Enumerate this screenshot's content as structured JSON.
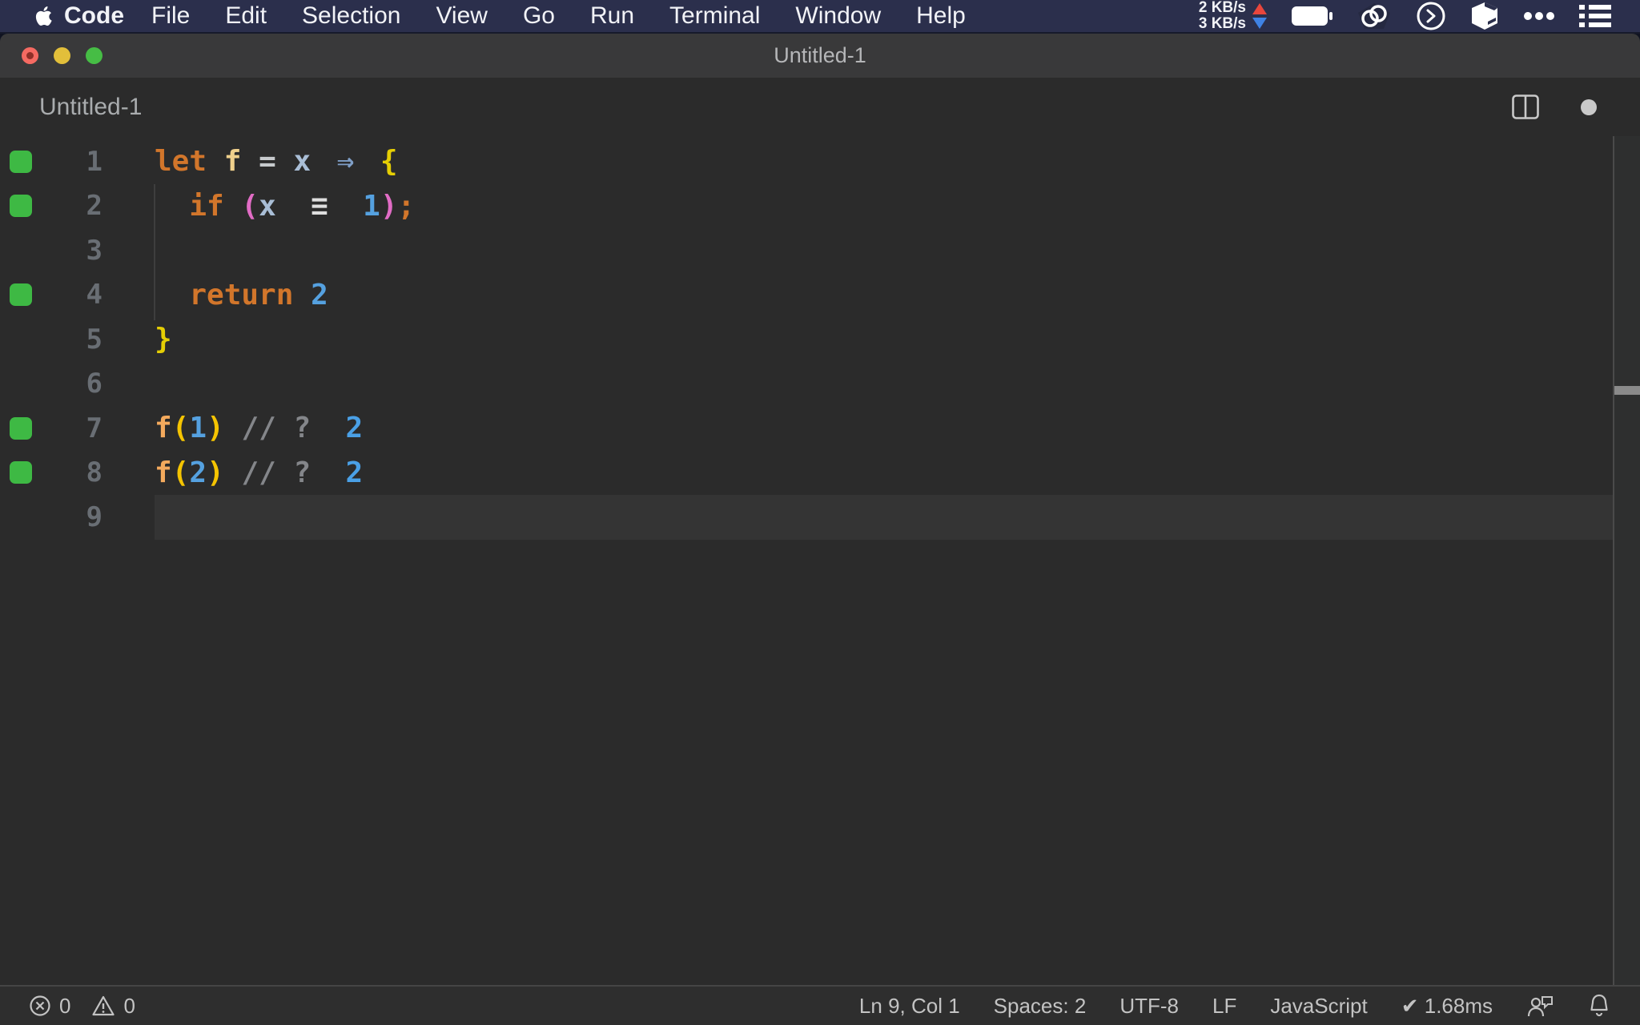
{
  "menu_bar": {
    "app_name": "Code",
    "items": [
      "File",
      "Edit",
      "Selection",
      "View",
      "Go",
      "Run",
      "Terminal",
      "Window",
      "Help"
    ],
    "network_up": "2 KB/s",
    "network_down": "3 KB/s",
    "right_icons": [
      "battery-icon",
      "linked-rings-icon",
      "terminal-circle-icon",
      "cube-icon",
      "ellipsis-icon",
      "list-icon"
    ]
  },
  "window": {
    "title": "Untitled-1"
  },
  "tab": {
    "label": "Untitled-1"
  },
  "editor": {
    "language_hint": "JavaScript",
    "lines": [
      {
        "n": "1",
        "mark": true,
        "tokens": [
          {
            "t": "let",
            "c": "kw"
          },
          {
            "t": " "
          },
          {
            "t": "f",
            "c": "fnd"
          },
          {
            "t": " "
          },
          {
            "t": "=",
            "c": "op"
          },
          {
            "t": " "
          },
          {
            "t": "x",
            "c": "var"
          },
          {
            "t": " "
          },
          {
            "t": "⇒",
            "c": "arrow",
            "w": 2
          },
          {
            "t": " "
          },
          {
            "t": "{",
            "c": "brace"
          }
        ]
      },
      {
        "n": "2",
        "mark": true,
        "tokens": [
          {
            "t": "  "
          },
          {
            "t": "if",
            "c": "kw"
          },
          {
            "t": " "
          },
          {
            "t": "(",
            "c": "paren2"
          },
          {
            "t": "x",
            "c": "var"
          },
          {
            "t": " "
          },
          {
            "t": "≡",
            "c": "eq",
            "w": 3
          },
          {
            "t": " "
          },
          {
            "t": "1",
            "c": "num"
          },
          {
            "t": ")",
            "c": "paren2"
          },
          {
            "t": ";",
            "c": "kw"
          }
        ]
      },
      {
        "n": "3",
        "mark": false,
        "tokens": []
      },
      {
        "n": "4",
        "mark": true,
        "tokens": [
          {
            "t": "  "
          },
          {
            "t": "return",
            "c": "kw"
          },
          {
            "t": " "
          },
          {
            "t": "2",
            "c": "num"
          }
        ]
      },
      {
        "n": "5",
        "mark": false,
        "tokens": [
          {
            "t": "}",
            "c": "brace"
          }
        ]
      },
      {
        "n": "6",
        "mark": false,
        "tokens": []
      },
      {
        "n": "7",
        "mark": true,
        "tokens": [
          {
            "t": "f",
            "c": "fnc"
          },
          {
            "t": "(",
            "c": "paren1"
          },
          {
            "t": "1",
            "c": "num"
          },
          {
            "t": ")",
            "c": "paren1"
          },
          {
            "t": " "
          },
          {
            "t": "//",
            "c": "cmt"
          },
          {
            "t": " "
          },
          {
            "t": "?",
            "c": "cmt"
          },
          {
            "t": "  "
          },
          {
            "t": "2",
            "c": "res"
          }
        ]
      },
      {
        "n": "8",
        "mark": true,
        "tokens": [
          {
            "t": "f",
            "c": "fnc"
          },
          {
            "t": "(",
            "c": "paren1"
          },
          {
            "t": "2",
            "c": "num"
          },
          {
            "t": ")",
            "c": "paren1"
          },
          {
            "t": " "
          },
          {
            "t": "//",
            "c": "cmt"
          },
          {
            "t": " "
          },
          {
            "t": "?",
            "c": "cmt"
          },
          {
            "t": "  "
          },
          {
            "t": "2",
            "c": "res"
          }
        ]
      },
      {
        "n": "9",
        "mark": false,
        "current": true,
        "tokens": []
      }
    ]
  },
  "status_bar": {
    "errors": "0",
    "warnings": "0",
    "items": [
      "Ln 9, Col 1",
      "Spaces: 2",
      "UTF-8",
      "LF",
      "JavaScript",
      "✔ 1.68ms"
    ]
  },
  "colors": {
    "menubar_bg": "#2b2f4c",
    "titlebar_bg": "#39393a",
    "editor_bg": "#2b2b2b",
    "current_line_bg": "#343434",
    "statusbar_bg": "#2e2e2e",
    "coverage_green": "#3eb944",
    "traffic_red": "#f56a62",
    "traffic_yellow": "#e2bf3a",
    "traffic_green": "#46bd45",
    "net_up_arrow": "#e8463c",
    "net_down_arrow": "#3f82e4",
    "syntax": {
      "keyword": "#d2762b",
      "function_decl": "#f0d08c",
      "function_call": "#f4aa5d",
      "operator": "#c7cacd",
      "variable": "#a9bed6",
      "arrow": "#7f9fc7",
      "brace": "#e5ce04",
      "paren_level1": "#f5c402",
      "paren_level2": "#e16cc5",
      "number": "#55a1e0",
      "triple_equals": "#dedede",
      "comment": "#84868a",
      "inline_result": "#4aa0e6",
      "line_number": "#696e74"
    }
  }
}
